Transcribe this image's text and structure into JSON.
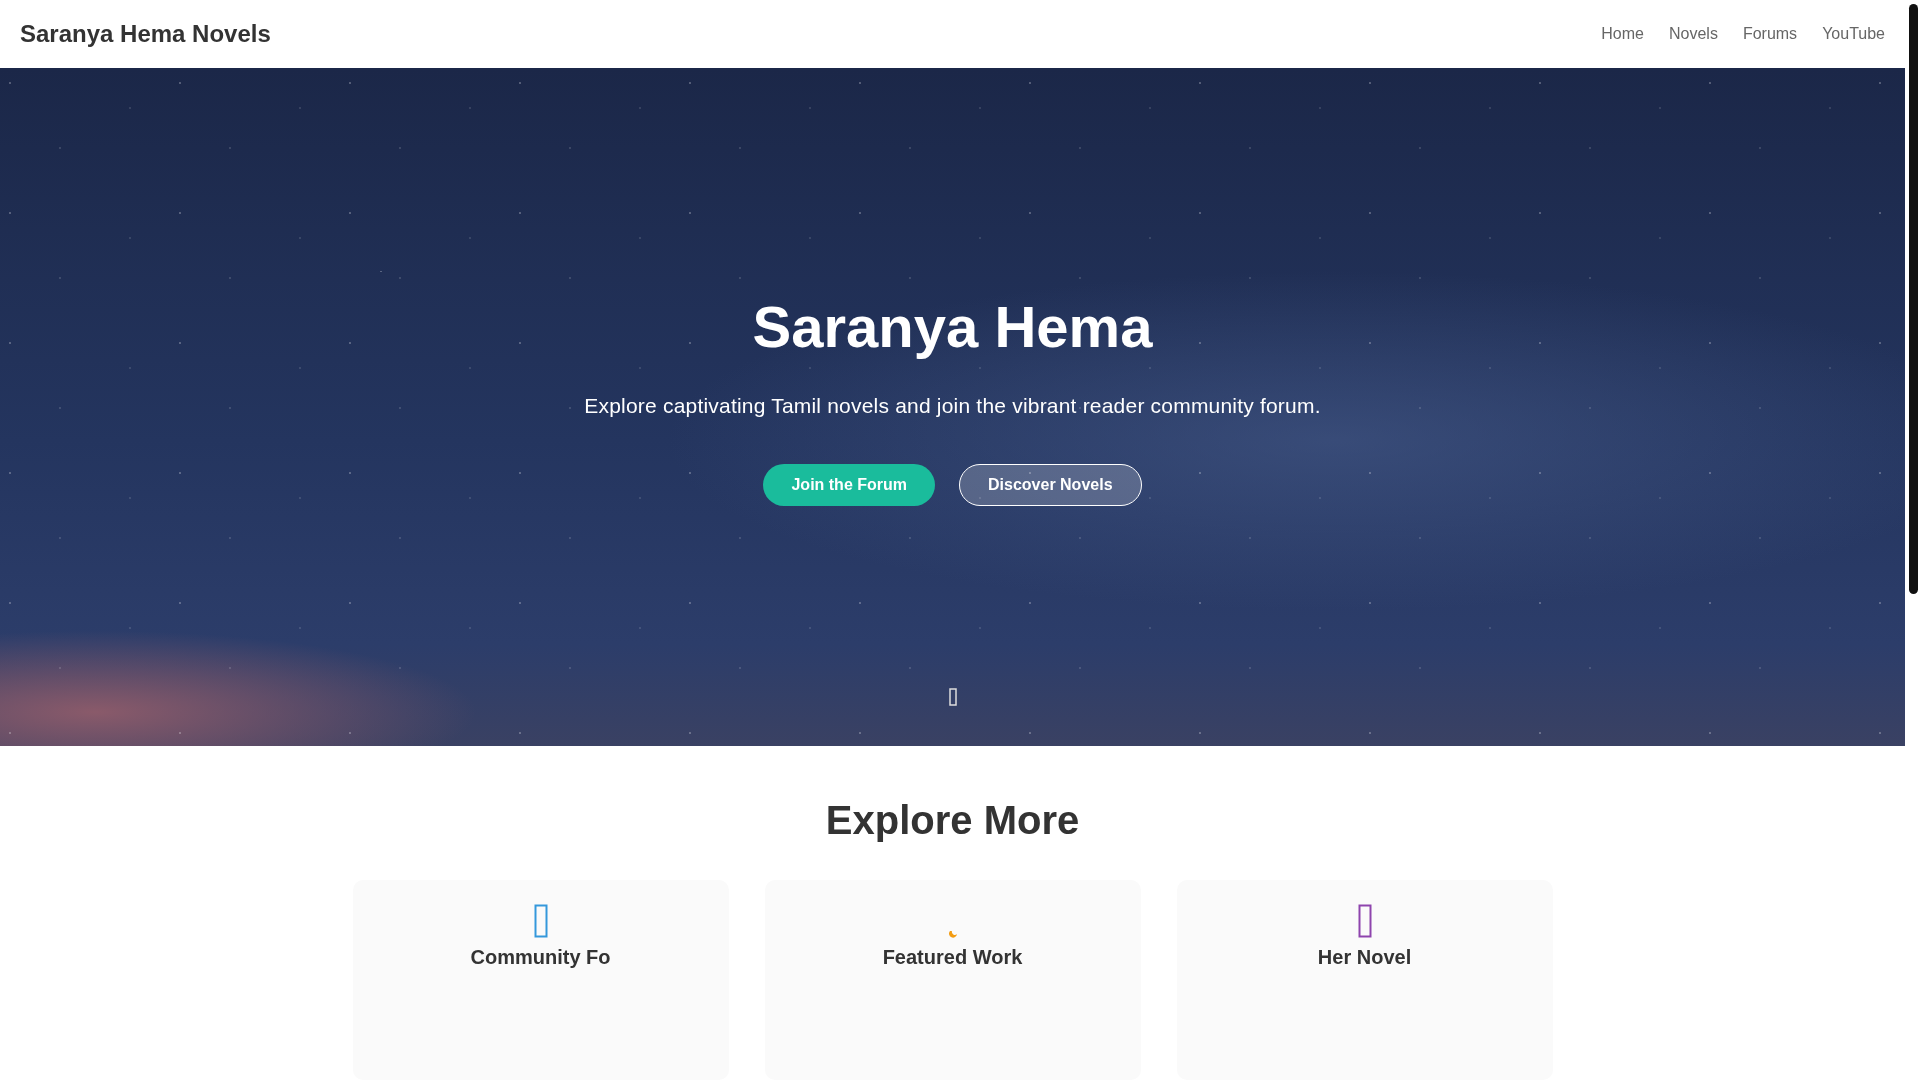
{
  "site_title": "Saranya Hema Novels",
  "nav": [
    {
      "label": "Home"
    },
    {
      "label": "Novels"
    },
    {
      "label": "Forums"
    },
    {
      "label": "YouTube"
    }
  ],
  "hero": {
    "title": "Saranya Hema",
    "subtitle": "Explore captivating Tamil novels and join the vibrant reader community forum.",
    "buttons": [
      {
        "label": "Join the Forum",
        "kind": "primary"
      },
      {
        "label": "Discover Novels",
        "kind": "outline"
      }
    ]
  },
  "section": {
    "title": "Explore More",
    "cards": [
      {
        "title": "Community Fo",
        "color": "#3498db"
      },
      {
        "title": "Featured Work",
        "color": "#f39c12"
      },
      {
        "title": "Her Novel",
        "color": "#8e44ad"
      }
    ]
  }
}
